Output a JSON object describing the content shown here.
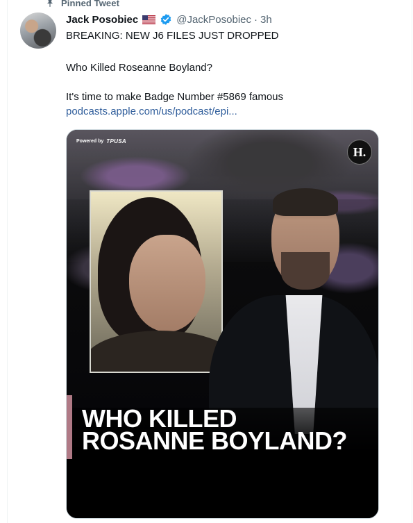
{
  "pinned": {
    "label": "Pinned Tweet"
  },
  "author": {
    "display_name": "Jack Posobiec",
    "handle": "@JackPosobiec",
    "separator": "·",
    "time": "3h",
    "flag": "us-flag-icon",
    "verified": "verified-badge-icon"
  },
  "tweet": {
    "line1": "BREAKING: NEW J6 FILES JUST DROPPED",
    "line2": "Who Killed Roseanne Boyland?",
    "line3": "It's time to make Badge Number #5869 famous",
    "link": "podcasts.apple.com/us/podcast/epi..."
  },
  "media": {
    "powered_by": "Powered by",
    "brand": "TPUSA",
    "logo_letter": "H.",
    "headline_line1": "WHO KILLED",
    "headline_line2": "ROSANNE BOYLAND?"
  },
  "colors": {
    "text_primary": "#0f1419",
    "text_secondary": "#536471",
    "link": "#2f5d9b",
    "verified": "#1d9bf0",
    "accent_bar": "#b07a86"
  }
}
